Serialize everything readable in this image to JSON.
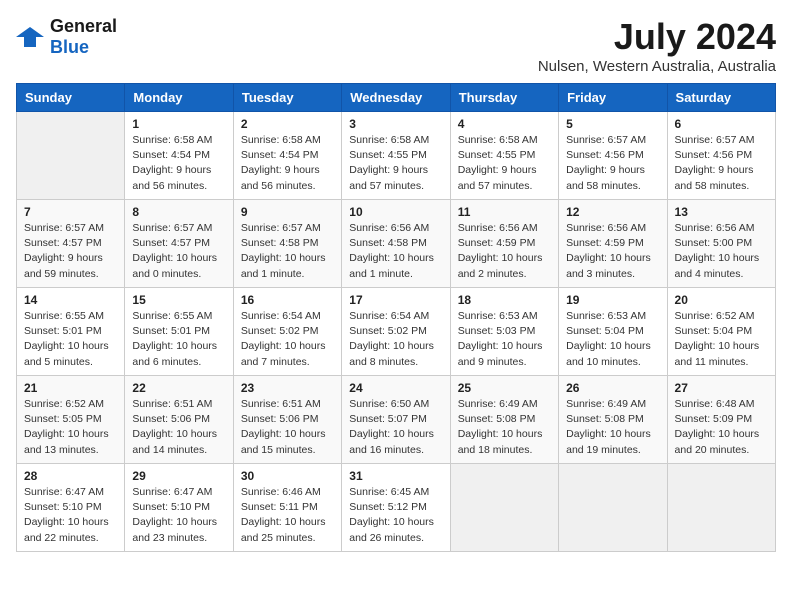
{
  "header": {
    "logo_general": "General",
    "logo_blue": "Blue",
    "title": "July 2024",
    "subtitle": "Nulsen, Western Australia, Australia"
  },
  "calendar": {
    "days_of_week": [
      "Sunday",
      "Monday",
      "Tuesday",
      "Wednesday",
      "Thursday",
      "Friday",
      "Saturday"
    ],
    "weeks": [
      [
        {
          "day": "",
          "sunrise": "",
          "sunset": "",
          "daylight": ""
        },
        {
          "day": "1",
          "sunrise": "Sunrise: 6:58 AM",
          "sunset": "Sunset: 4:54 PM",
          "daylight": "Daylight: 9 hours and 56 minutes."
        },
        {
          "day": "2",
          "sunrise": "Sunrise: 6:58 AM",
          "sunset": "Sunset: 4:54 PM",
          "daylight": "Daylight: 9 hours and 56 minutes."
        },
        {
          "day": "3",
          "sunrise": "Sunrise: 6:58 AM",
          "sunset": "Sunset: 4:55 PM",
          "daylight": "Daylight: 9 hours and 57 minutes."
        },
        {
          "day": "4",
          "sunrise": "Sunrise: 6:58 AM",
          "sunset": "Sunset: 4:55 PM",
          "daylight": "Daylight: 9 hours and 57 minutes."
        },
        {
          "day": "5",
          "sunrise": "Sunrise: 6:57 AM",
          "sunset": "Sunset: 4:56 PM",
          "daylight": "Daylight: 9 hours and 58 minutes."
        },
        {
          "day": "6",
          "sunrise": "Sunrise: 6:57 AM",
          "sunset": "Sunset: 4:56 PM",
          "daylight": "Daylight: 9 hours and 58 minutes."
        }
      ],
      [
        {
          "day": "7",
          "sunrise": "Sunrise: 6:57 AM",
          "sunset": "Sunset: 4:57 PM",
          "daylight": "Daylight: 9 hours and 59 minutes."
        },
        {
          "day": "8",
          "sunrise": "Sunrise: 6:57 AM",
          "sunset": "Sunset: 4:57 PM",
          "daylight": "Daylight: 10 hours and 0 minutes."
        },
        {
          "day": "9",
          "sunrise": "Sunrise: 6:57 AM",
          "sunset": "Sunset: 4:58 PM",
          "daylight": "Daylight: 10 hours and 1 minute."
        },
        {
          "day": "10",
          "sunrise": "Sunrise: 6:56 AM",
          "sunset": "Sunset: 4:58 PM",
          "daylight": "Daylight: 10 hours and 1 minute."
        },
        {
          "day": "11",
          "sunrise": "Sunrise: 6:56 AM",
          "sunset": "Sunset: 4:59 PM",
          "daylight": "Daylight: 10 hours and 2 minutes."
        },
        {
          "day": "12",
          "sunrise": "Sunrise: 6:56 AM",
          "sunset": "Sunset: 4:59 PM",
          "daylight": "Daylight: 10 hours and 3 minutes."
        },
        {
          "day": "13",
          "sunrise": "Sunrise: 6:56 AM",
          "sunset": "Sunset: 5:00 PM",
          "daylight": "Daylight: 10 hours and 4 minutes."
        }
      ],
      [
        {
          "day": "14",
          "sunrise": "Sunrise: 6:55 AM",
          "sunset": "Sunset: 5:01 PM",
          "daylight": "Daylight: 10 hours and 5 minutes."
        },
        {
          "day": "15",
          "sunrise": "Sunrise: 6:55 AM",
          "sunset": "Sunset: 5:01 PM",
          "daylight": "Daylight: 10 hours and 6 minutes."
        },
        {
          "day": "16",
          "sunrise": "Sunrise: 6:54 AM",
          "sunset": "Sunset: 5:02 PM",
          "daylight": "Daylight: 10 hours and 7 minutes."
        },
        {
          "day": "17",
          "sunrise": "Sunrise: 6:54 AM",
          "sunset": "Sunset: 5:02 PM",
          "daylight": "Daylight: 10 hours and 8 minutes."
        },
        {
          "day": "18",
          "sunrise": "Sunrise: 6:53 AM",
          "sunset": "Sunset: 5:03 PM",
          "daylight": "Daylight: 10 hours and 9 minutes."
        },
        {
          "day": "19",
          "sunrise": "Sunrise: 6:53 AM",
          "sunset": "Sunset: 5:04 PM",
          "daylight": "Daylight: 10 hours and 10 minutes."
        },
        {
          "day": "20",
          "sunrise": "Sunrise: 6:52 AM",
          "sunset": "Sunset: 5:04 PM",
          "daylight": "Daylight: 10 hours and 11 minutes."
        }
      ],
      [
        {
          "day": "21",
          "sunrise": "Sunrise: 6:52 AM",
          "sunset": "Sunset: 5:05 PM",
          "daylight": "Daylight: 10 hours and 13 minutes."
        },
        {
          "day": "22",
          "sunrise": "Sunrise: 6:51 AM",
          "sunset": "Sunset: 5:06 PM",
          "daylight": "Daylight: 10 hours and 14 minutes."
        },
        {
          "day": "23",
          "sunrise": "Sunrise: 6:51 AM",
          "sunset": "Sunset: 5:06 PM",
          "daylight": "Daylight: 10 hours and 15 minutes."
        },
        {
          "day": "24",
          "sunrise": "Sunrise: 6:50 AM",
          "sunset": "Sunset: 5:07 PM",
          "daylight": "Daylight: 10 hours and 16 minutes."
        },
        {
          "day": "25",
          "sunrise": "Sunrise: 6:49 AM",
          "sunset": "Sunset: 5:08 PM",
          "daylight": "Daylight: 10 hours and 18 minutes."
        },
        {
          "day": "26",
          "sunrise": "Sunrise: 6:49 AM",
          "sunset": "Sunset: 5:08 PM",
          "daylight": "Daylight: 10 hours and 19 minutes."
        },
        {
          "day": "27",
          "sunrise": "Sunrise: 6:48 AM",
          "sunset": "Sunset: 5:09 PM",
          "daylight": "Daylight: 10 hours and 20 minutes."
        }
      ],
      [
        {
          "day": "28",
          "sunrise": "Sunrise: 6:47 AM",
          "sunset": "Sunset: 5:10 PM",
          "daylight": "Daylight: 10 hours and 22 minutes."
        },
        {
          "day": "29",
          "sunrise": "Sunrise: 6:47 AM",
          "sunset": "Sunset: 5:10 PM",
          "daylight": "Daylight: 10 hours and 23 minutes."
        },
        {
          "day": "30",
          "sunrise": "Sunrise: 6:46 AM",
          "sunset": "Sunset: 5:11 PM",
          "daylight": "Daylight: 10 hours and 25 minutes."
        },
        {
          "day": "31",
          "sunrise": "Sunrise: 6:45 AM",
          "sunset": "Sunset: 5:12 PM",
          "daylight": "Daylight: 10 hours and 26 minutes."
        },
        {
          "day": "",
          "sunrise": "",
          "sunset": "",
          "daylight": ""
        },
        {
          "day": "",
          "sunrise": "",
          "sunset": "",
          "daylight": ""
        },
        {
          "day": "",
          "sunrise": "",
          "sunset": "",
          "daylight": ""
        }
      ]
    ]
  }
}
